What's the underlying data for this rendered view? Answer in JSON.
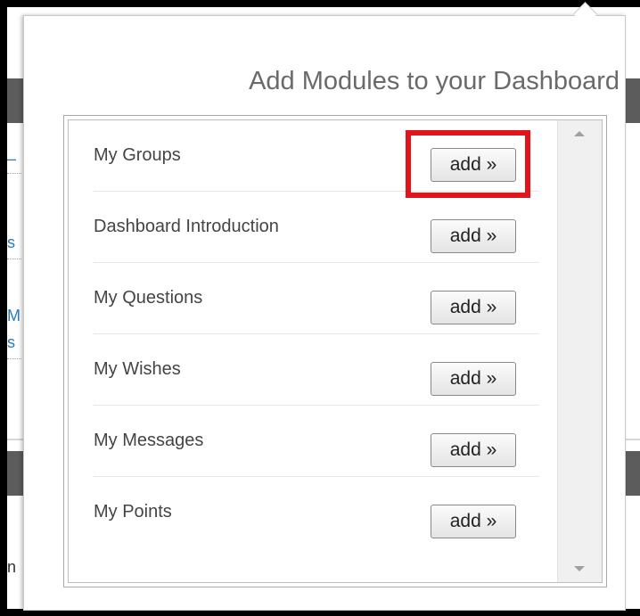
{
  "dialog": {
    "title": "Add Modules to your Dashboard"
  },
  "modules": [
    {
      "name": "My Groups",
      "button_label": "add »",
      "highlighted": true
    },
    {
      "name": "Dashboard Introduction",
      "button_label": "add »",
      "highlighted": false
    },
    {
      "name": "My Questions",
      "button_label": "add »",
      "highlighted": false
    },
    {
      "name": "My Wishes",
      "button_label": "add »",
      "highlighted": false
    },
    {
      "name": "My Messages",
      "button_label": "add »",
      "highlighted": false
    },
    {
      "name": "My Points",
      "button_label": "add »",
      "highlighted": false
    }
  ],
  "background_fragments": [
    "s",
    "M",
    "s",
    "n"
  ],
  "colors": {
    "highlight": "#e1141b",
    "title_text": "#6a6a6a",
    "background_link": "#2d7bbd"
  },
  "icons": {
    "scroll_up": "scroll-up-arrow-icon",
    "scroll_down": "scroll-down-arrow-icon"
  }
}
